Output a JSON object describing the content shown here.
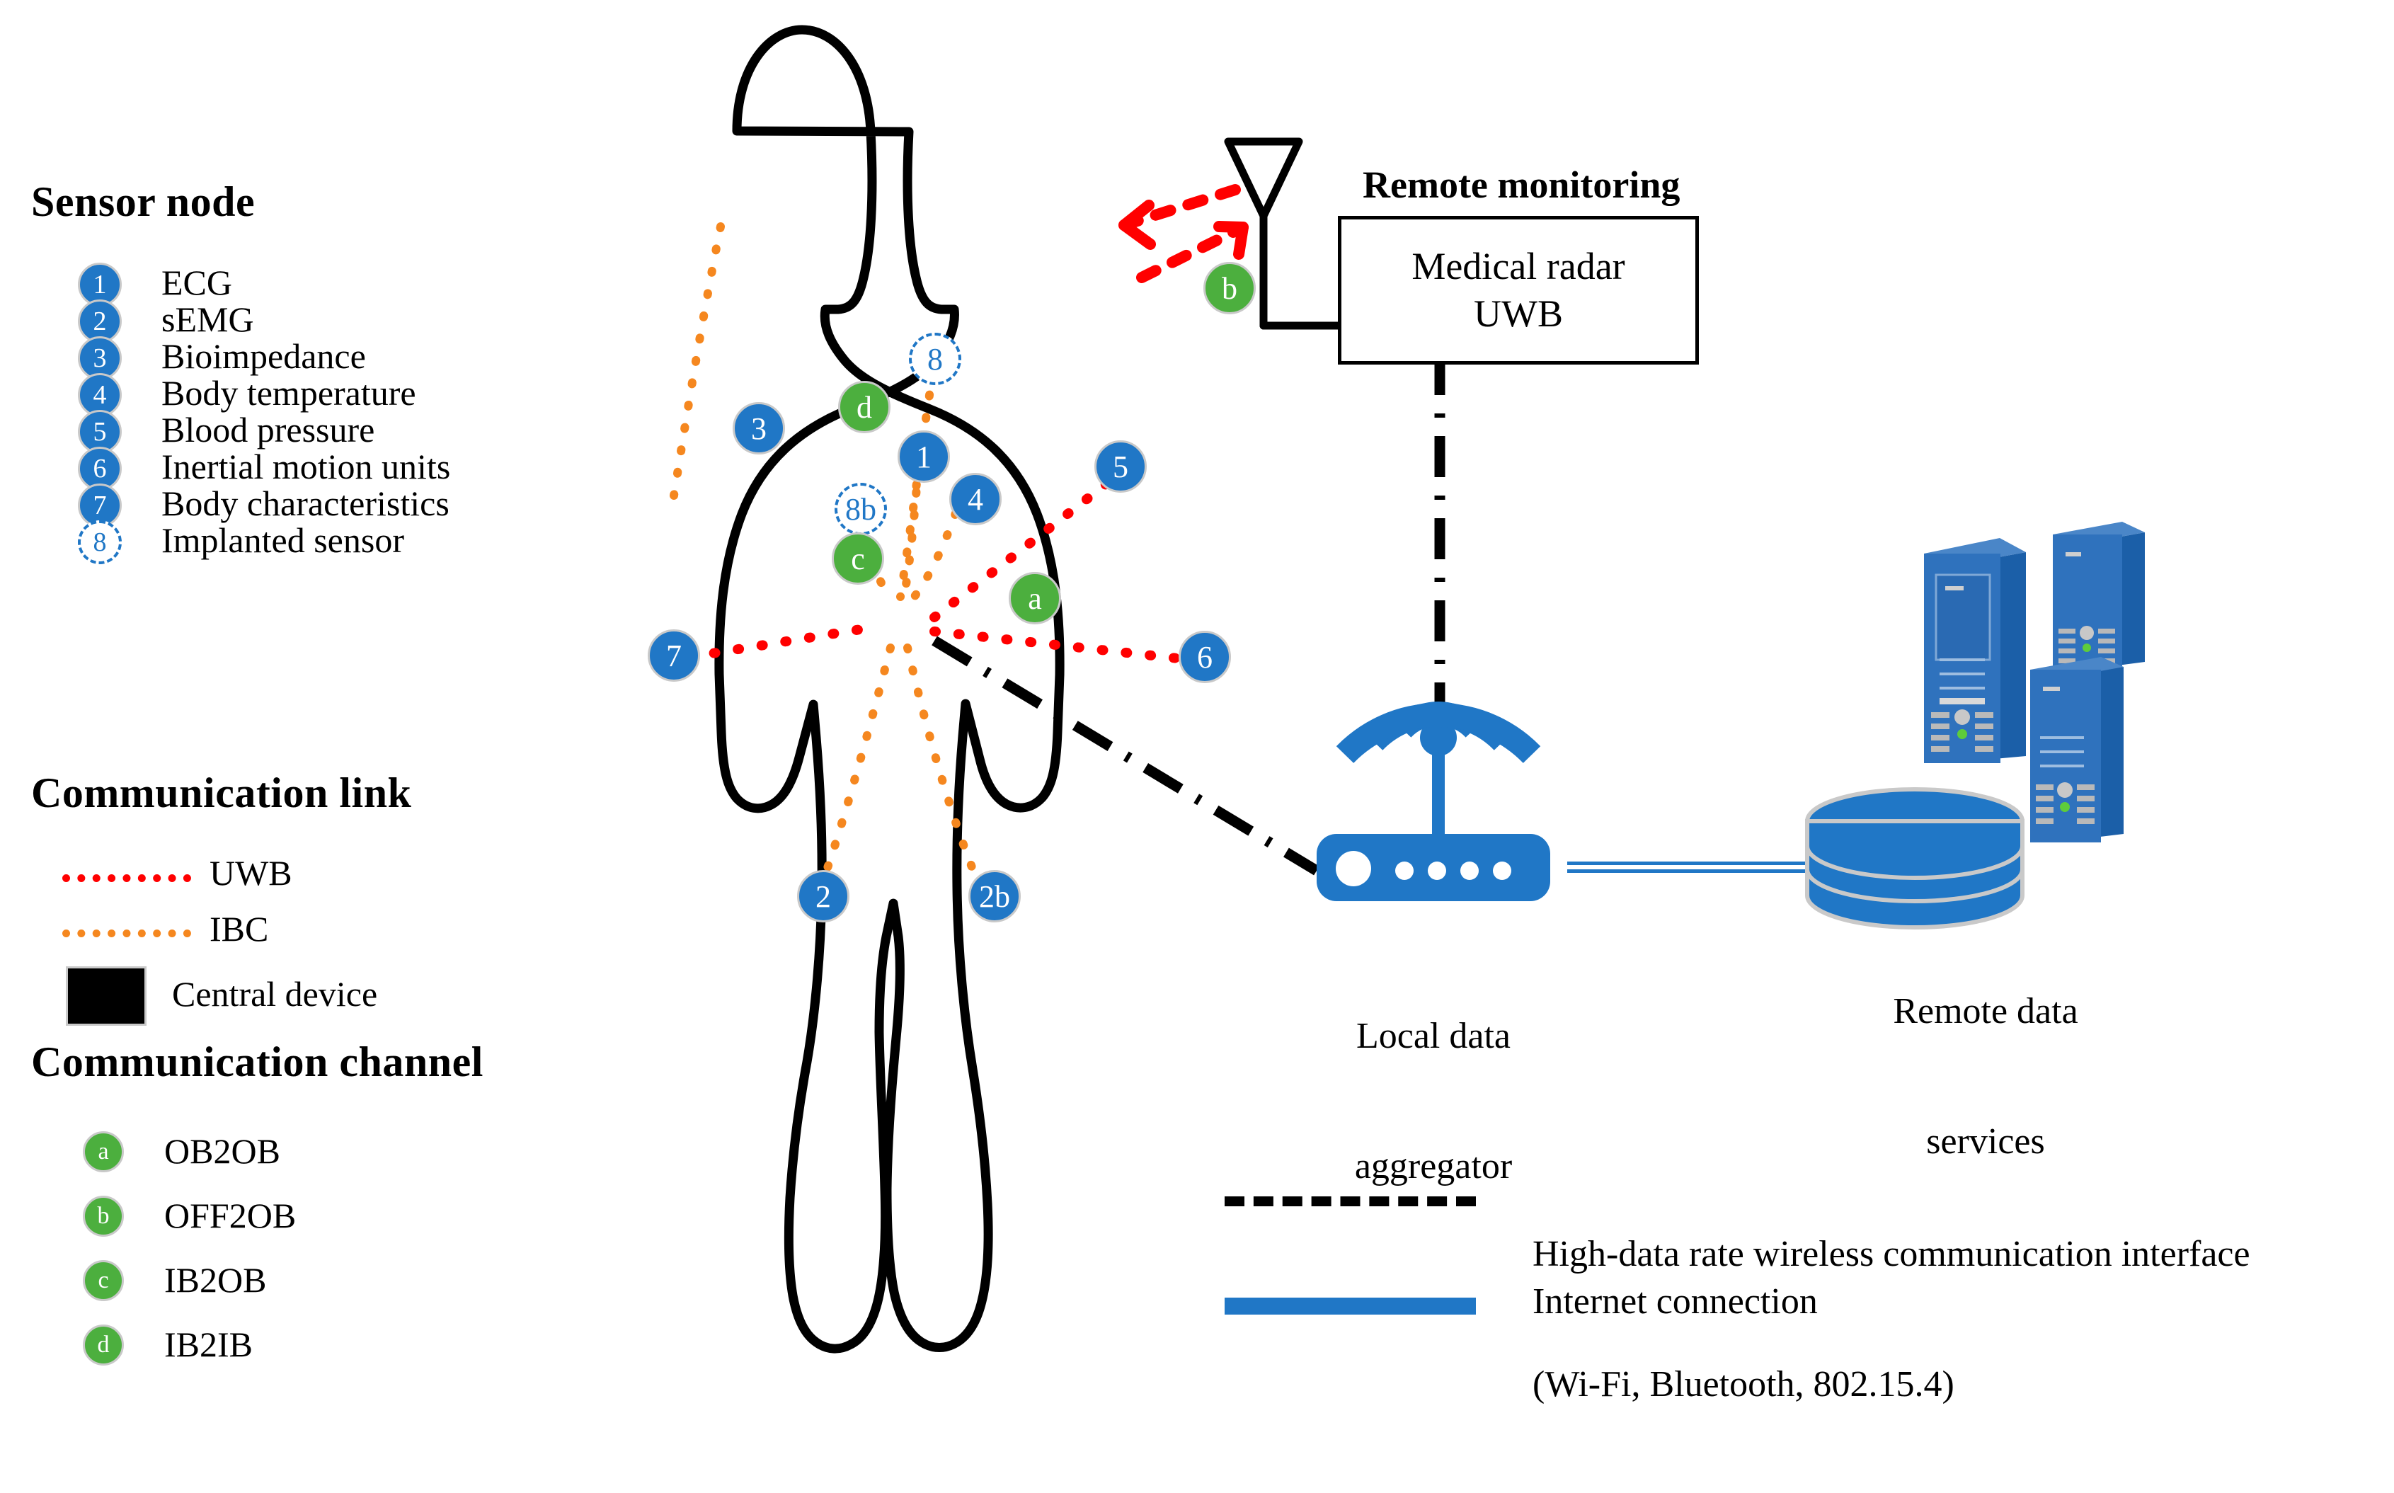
{
  "legend": {
    "sensor_node": {
      "title": "Sensor node",
      "items": [
        {
          "id": "1",
          "label": "ECG",
          "style": "blue"
        },
        {
          "id": "2",
          "label": "sEMG",
          "style": "blue"
        },
        {
          "id": "3",
          "label": "Bioimpedance",
          "style": "blue"
        },
        {
          "id": "4",
          "label": "Body temperature",
          "style": "blue"
        },
        {
          "id": "5",
          "label": "Blood pressure",
          "style": "blue"
        },
        {
          "id": "6",
          "label": "Inertial motion units",
          "style": "blue"
        },
        {
          "id": "7",
          "label": "Body characteristics",
          "style": "blue"
        },
        {
          "id": "8",
          "label": "Implanted sensor",
          "style": "dashed"
        }
      ]
    },
    "communication_link": {
      "title": "Communication link",
      "items": [
        {
          "id": "uwb",
          "label": "UWB",
          "style": "dotted",
          "color": "#ff0000"
        },
        {
          "id": "ibc",
          "label": "IBC",
          "style": "dotted",
          "color": "#f5871f"
        },
        {
          "id": "central",
          "label": "Central device",
          "style": "square",
          "color": "#000000"
        }
      ]
    },
    "communication_channel": {
      "title": "Communication channel",
      "items": [
        {
          "id": "a",
          "label": "OB2OB"
        },
        {
          "id": "b",
          "label": "OFF2OB"
        },
        {
          "id": "c",
          "label": "IB2OB"
        },
        {
          "id": "d",
          "label": "IB2IB"
        }
      ]
    }
  },
  "body_nodes": [
    {
      "id": "8",
      "type": "implanted",
      "note": "upper-chest implant"
    },
    {
      "id": "d",
      "type": "channel",
      "note": "IB2IB channel marker"
    },
    {
      "id": "1",
      "type": "sensor",
      "note": "ECG on chest"
    },
    {
      "id": "3",
      "type": "sensor",
      "note": "Bioimpedance on right upper arm"
    },
    {
      "id": "4",
      "type": "sensor",
      "note": "Body temperature on chest"
    },
    {
      "id": "5",
      "type": "sensor",
      "note": "Blood pressure on left upper arm"
    },
    {
      "id": "8b",
      "type": "implanted",
      "note": "abdominal implant"
    },
    {
      "id": "c",
      "type": "channel",
      "note": "IB2OB channel marker"
    },
    {
      "id": "a",
      "type": "channel",
      "note": "OB2OB channel marker"
    },
    {
      "id": "7",
      "type": "sensor",
      "note": "Body characteristics at right wrist"
    },
    {
      "id": "6",
      "type": "sensor",
      "note": "Inertial motion units at left wrist"
    },
    {
      "id": "2",
      "type": "sensor",
      "note": "sEMG right leg"
    },
    {
      "id": "2b",
      "type": "sensor",
      "note": "sEMG left leg"
    }
  ],
  "remote_monitoring": {
    "title": "Remote monitoring",
    "device_line1": "Medical radar",
    "device_line2": "UWB",
    "channel_marker": "b"
  },
  "aggregator": {
    "label_line1": "Local data",
    "label_line2": "aggregator"
  },
  "remote_services": {
    "label_line1": "Remote data",
    "label_line2": "services"
  },
  "interface_legend": [
    {
      "id": "high-data-rate",
      "style": "dash-dot",
      "line1": "High-data rate wireless communication interface",
      "line2": "(Wi-Fi, Bluetooth, 802.15.4)"
    },
    {
      "id": "internet",
      "style": "double-line",
      "line1": "Internet connection",
      "line2": ""
    }
  ],
  "colors": {
    "sensor_blue": "#2077c6",
    "channel_green": "#4caf3e",
    "uwb_red": "#ff0000",
    "ibc_orange": "#f5871f",
    "central_black": "#000000",
    "internet_blue": "#2077c6"
  }
}
